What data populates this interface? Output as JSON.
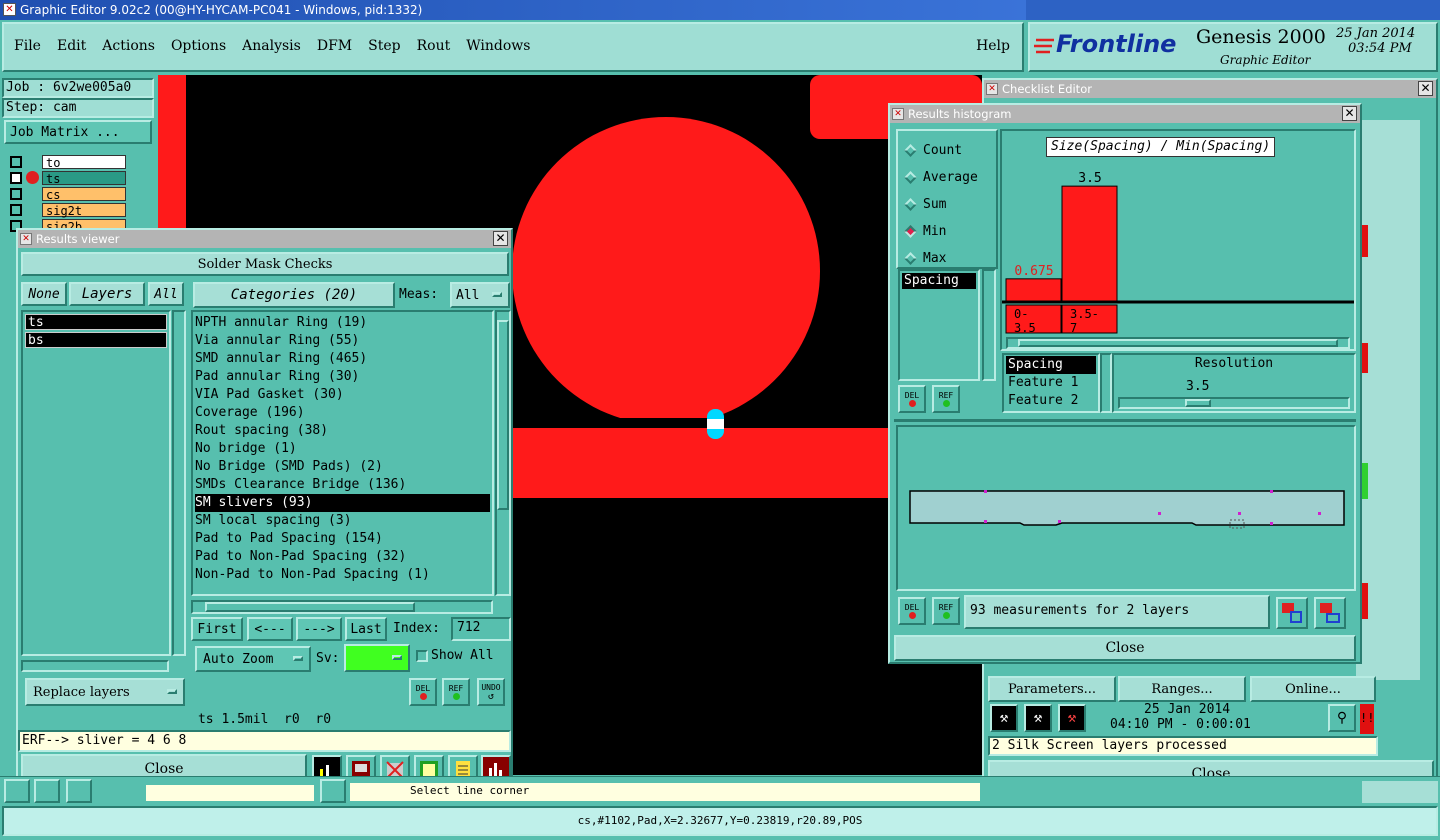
{
  "window": {
    "title": "Graphic Editor 9.02c2 (00@HY-HYCAM-PC041 - Windows, pid:1332)"
  },
  "menu": [
    "File",
    "Edit",
    "Actions",
    "Options",
    "Analysis",
    "DFM",
    "Step",
    "Rout",
    "Windows"
  ],
  "help_label": "Help",
  "brand": {
    "logo": "Frontline",
    "product": "Genesis 2000",
    "subtitle": "Graphic Editor",
    "date": "25 Jan 2014",
    "time": "03:54 PM"
  },
  "job_panel": {
    "job": "Job : 6v2we005a0",
    "step": "Step: cam",
    "job_matrix": "Job Matrix ...",
    "layers": [
      {
        "name": "to",
        "color": "#ffffff"
      },
      {
        "name": "ts",
        "color": "#2a9a86"
      },
      {
        "name": "cs",
        "color": "#ffc06a"
      },
      {
        "name": "sig2t",
        "color": "#ffc06a"
      },
      {
        "name": "sig2b",
        "color": "#ffc06a"
      }
    ]
  },
  "results_viewer": {
    "title": "Results viewer",
    "header": "Solder Mask Checks",
    "none_label": "None",
    "layers_label": "Layers",
    "all_label": "All",
    "layers": [
      "ts",
      "bs"
    ],
    "categories_label": "Categories (20)",
    "meas_label": "Meas:",
    "meas_value": "All",
    "categories": [
      "NPTH annular Ring (19)",
      "Via annular Ring (55)",
      "SMD annular Ring (465)",
      "Pad annular Ring (30)",
      "VIA Pad Gasket (30)",
      "Coverage (196)",
      "Rout spacing (38)",
      "No bridge (1)",
      "No Bridge (SMD Pads) (2)",
      "SMDs Clearance Bridge (136)",
      "SM slivers (93)",
      "SM local spacing (3)",
      "Pad to Pad Spacing (154)",
      "Pad to Non-Pad Spacing (32)",
      "Non-Pad to Non-Pad Spacing (1)"
    ],
    "selected_category": "SM slivers (93)",
    "nav": {
      "first": "First",
      "prev": "<---",
      "next": "--->",
      "last": "Last",
      "index_label": "Index:",
      "index_value": "712"
    },
    "auto_zoom": "Auto Zoom",
    "sv_label": "Sv:",
    "show_all": "Show All",
    "replace_layers": "Replace layers",
    "del": "DEL",
    "ref": "REF",
    "undo": "UNDO",
    "info_line": "ts 1.5mil  r0  r0",
    "erf_line": "ERF--> sliver = 4 6 8",
    "close": "Close"
  },
  "histogram": {
    "title": "Results histogram",
    "modes": [
      {
        "label": "Count",
        "on": false
      },
      {
        "label": "Average",
        "on": false
      },
      {
        "label": "Sum",
        "on": false
      },
      {
        "label": "Min",
        "on": true
      },
      {
        "label": "Max",
        "on": false
      }
    ],
    "field_list": [
      "Spacing"
    ],
    "chart_title": "Size(Spacing) / Min(Spacing)",
    "field_list2": [
      "Spacing",
      "Feature 1",
      "Feature 2"
    ],
    "resolution_label": "Resolution",
    "resolution_value": "3.5",
    "resolution_fraction": 0.32,
    "del": "DEL",
    "ref": "REF",
    "status": "93 measurements for 2 layers",
    "close": "Close"
  },
  "chart_data": {
    "type": "bar",
    "title": "Size(Spacing) / Min(Spacing)",
    "categories": [
      "0-\n3.5",
      "3.5-\n7"
    ],
    "values": [
      0.675,
      3.5
    ],
    "data_labels": [
      "0.675",
      "3.5"
    ],
    "ylim": [
      0,
      3.9
    ],
    "color": "#ff1a1a"
  },
  "checklist": {
    "title": "Checklist Editor",
    "parameters": "Parameters...",
    "ranges": "Ranges...",
    "online": "Online...",
    "date": "25 Jan 2014",
    "time": "04:10 PM - 0:00:01",
    "status": "2 Silk Screen layers processed",
    "close": "Close"
  },
  "bottom_status": "cs,#1102,Pad,X=2.32677,Y=0.23819,r20.89,POS",
  "behind_text": "Select line corner"
}
